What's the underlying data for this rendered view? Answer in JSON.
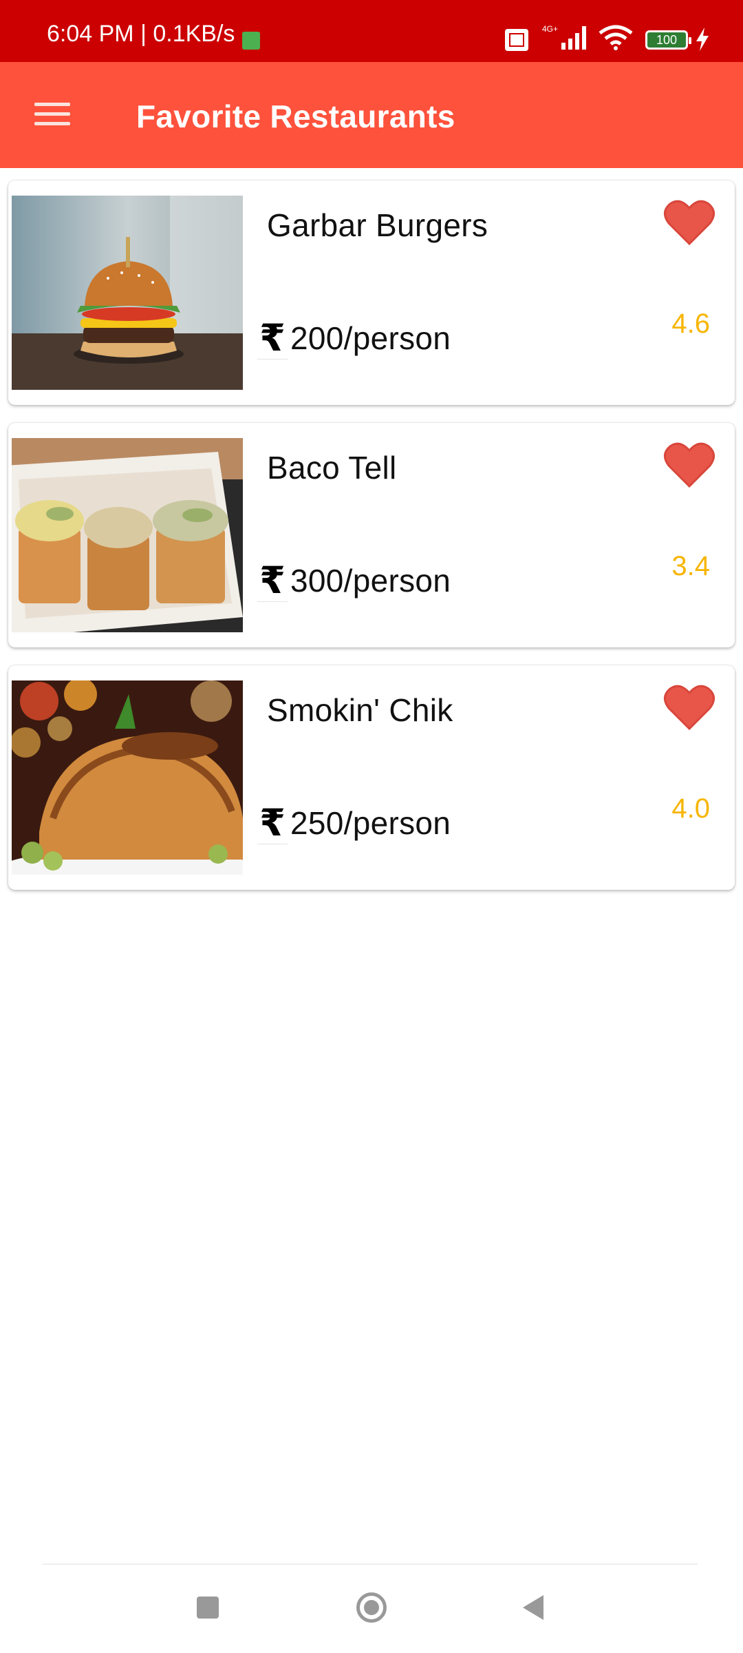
{
  "status_bar": {
    "time_speed": "6:04 PM | 0.1KB/s",
    "network": "4G+",
    "battery": "100"
  },
  "app_bar": {
    "menu_icon": "hamburger-menu-icon",
    "title": "Favorite Restaurants"
  },
  "colors": {
    "status_bar": "#cc0000",
    "app_bar": "#fe523c",
    "rating": "#f7b500",
    "heart": "#e8564a"
  },
  "restaurants": [
    {
      "name": "Garbar Burgers",
      "currency_symbol": "₹",
      "price": "200/person",
      "rating": "4.6",
      "image": "burger-photo",
      "favorite": true
    },
    {
      "name": "Baco Tell",
      "currency_symbol": "₹",
      "price": "300/person",
      "rating": "3.4",
      "image": "tacos-photo",
      "favorite": true
    },
    {
      "name": "Smokin' Chik",
      "currency_symbol": "₹",
      "price": "250/person",
      "rating": "4.0",
      "image": "roast-chicken-photo",
      "favorite": true
    }
  ],
  "nav_bar": {
    "buttons": [
      "recents-icon",
      "home-icon",
      "back-icon"
    ]
  }
}
